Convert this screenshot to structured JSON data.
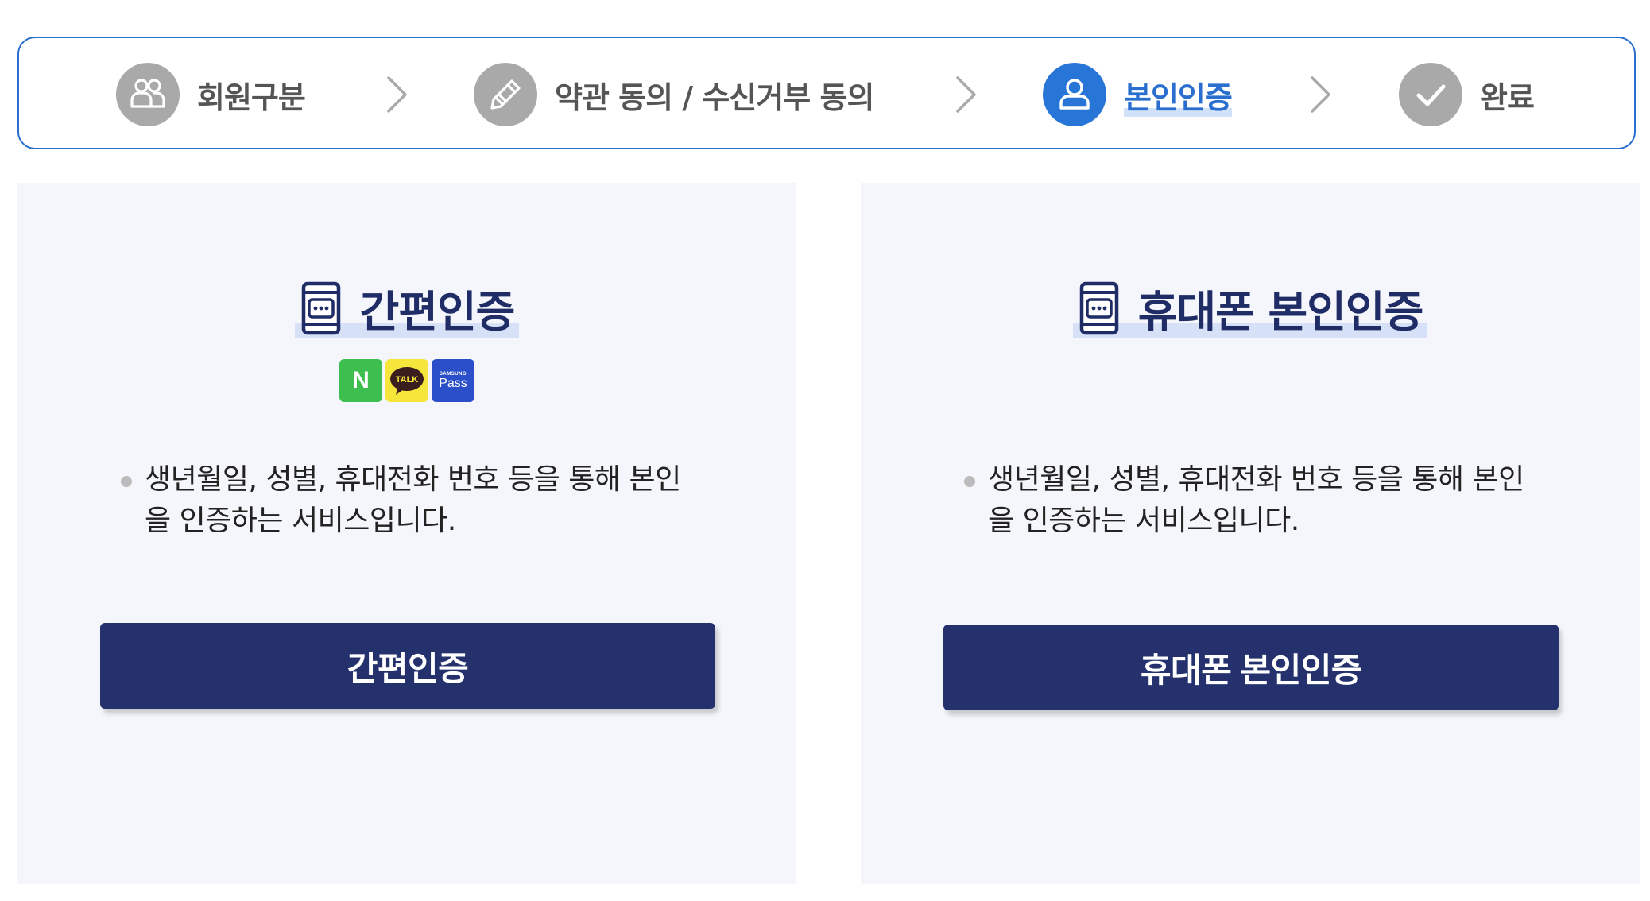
{
  "stepper": {
    "steps": [
      {
        "label": "회원구분",
        "icon": "members-icon",
        "active": false
      },
      {
        "label": "약관 동의 / 수신거부 동의",
        "icon": "pencil-icon",
        "active": false
      },
      {
        "label": "본인인증",
        "icon": "user-icon",
        "active": true
      },
      {
        "label": "완료",
        "icon": "check-icon",
        "active": false
      }
    ]
  },
  "cards": [
    {
      "title": "간편인증",
      "icon": "mobile-phone-icon",
      "logos": [
        {
          "name": "naver-logo",
          "text": "N"
        },
        {
          "name": "kakao-talk-logo",
          "text": "TALK"
        },
        {
          "name": "samsung-pass-logo",
          "text": "Pass",
          "subtext": "SAMSUNG"
        }
      ],
      "description": "생년월일, 성별, 휴대전화 번호 등을 통해 본인을 인증하는 서비스입니다.",
      "button": "간편인증"
    },
    {
      "title": "휴대폰 본인인증",
      "icon": "mobile-phone-icon",
      "description": "생년월일, 성별, 휴대전화 번호 등을 통해 본인을 인증하는 서비스입니다.",
      "button": "휴대폰 본인인증"
    }
  ],
  "colors": {
    "accent": "#2a6fcf",
    "step_inactive": "#a9a9a9",
    "button_bg": "#24316d",
    "card_bg": "#f4f6fb",
    "title_text": "#1f2c66"
  }
}
